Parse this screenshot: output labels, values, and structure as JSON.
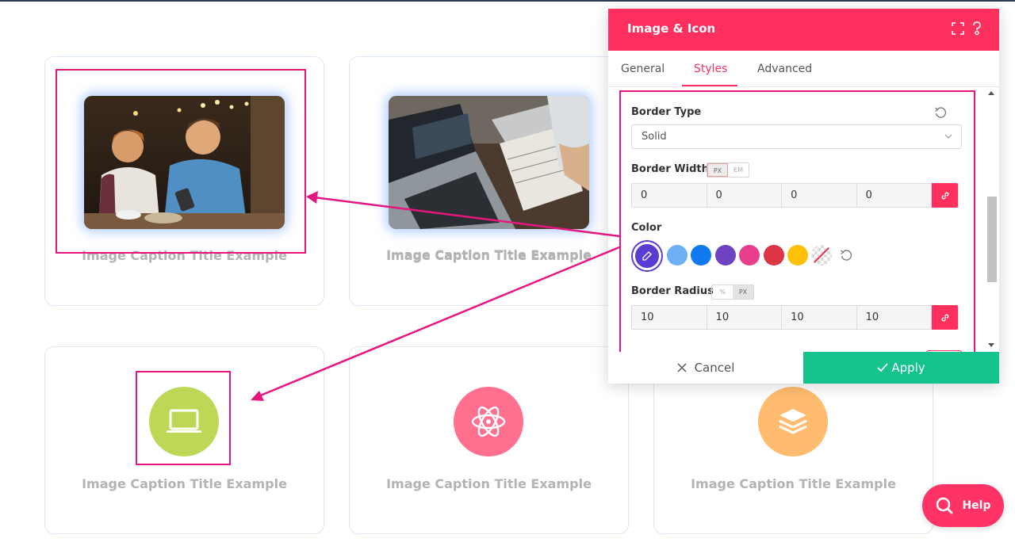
{
  "panel": {
    "title": "Image & Icon",
    "tabs": [
      {
        "label": "General"
      },
      {
        "label": "Styles"
      },
      {
        "label": "Advanced"
      }
    ],
    "border_type": {
      "label": "Border Type",
      "value": "Solid"
    },
    "border_width": {
      "label": "Border Width",
      "units": [
        "PX",
        "EM"
      ],
      "values": [
        "0",
        "0",
        "0",
        "0"
      ]
    },
    "color": {
      "label": "Color",
      "swatches": [
        "#6db0f5",
        "#0f7af0",
        "#6f42c1",
        "#e83e8c",
        "#dc3545",
        "#ffc107"
      ],
      "selected": "#5a3bd4"
    },
    "border_radius": {
      "label": "Border Radius",
      "units": [
        "%",
        "PX"
      ],
      "values": [
        "10",
        "10",
        "10",
        "10"
      ]
    },
    "cancel_label": "Cancel",
    "apply_label": "Apply"
  },
  "cards": [
    {
      "caption": "Image Caption Title Example"
    },
    {
      "caption": "Image Caption Title Example"
    },
    {
      "caption": "Image Caption Title Example"
    },
    {
      "caption": "Image Caption Title Example"
    },
    {
      "caption": "Image Caption Title Example"
    }
  ],
  "help_label": "Help",
  "colors": {
    "accent": "#ff2f5e",
    "apply": "#14c38e",
    "highlight": "#e6157f",
    "green_icon": "#bdd857",
    "pink_icon": "#ff6f8e",
    "orange_icon": "#ffbb6e"
  }
}
